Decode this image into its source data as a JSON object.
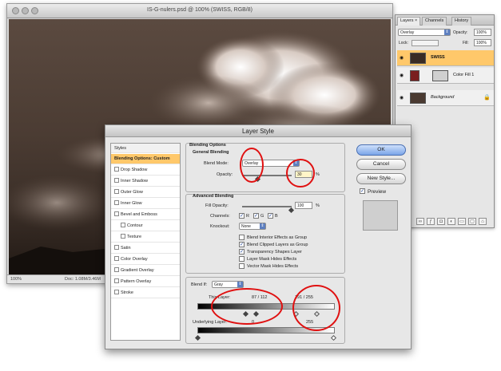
{
  "document_window": {
    "title": "IS-G-nulers.psd @ 100% (SWISS, RGB/8)",
    "zoom": "100%",
    "doc_size": "Doc: 1.08M/3.46M"
  },
  "layers_panel": {
    "tabs": [
      "Layers ×",
      "Channels",
      "History"
    ],
    "blend_mode": "Overlay",
    "opacity_label": "Opacity:",
    "opacity_value": "100%",
    "lock_label": "Lock:",
    "fill_label": "Fill:",
    "fill_value": "100%",
    "layers": [
      {
        "name": "SWISS",
        "selected": true
      },
      {
        "name": "Color Fill 1",
        "selected": false
      },
      {
        "name": "Background",
        "selected": false
      }
    ],
    "bottom_icons": [
      "link-icon",
      "fx-icon",
      "mask-icon",
      "adjustment-icon",
      "folder-icon",
      "new-layer-icon",
      "trash-icon"
    ]
  },
  "layer_style": {
    "title": "Layer Style",
    "styles_header": "Styles",
    "styles_list": [
      {
        "label": "Blending Options: Custom",
        "selected": true,
        "checkbox": false,
        "sub": false
      },
      {
        "label": "Drop Shadow",
        "selected": false,
        "checkbox": true,
        "sub": false
      },
      {
        "label": "Inner Shadow",
        "selected": false,
        "checkbox": true,
        "sub": false
      },
      {
        "label": "Outer Glow",
        "selected": false,
        "checkbox": true,
        "sub": false
      },
      {
        "label": "Inner Glow",
        "selected": false,
        "checkbox": true,
        "sub": false
      },
      {
        "label": "Bevel and Emboss",
        "selected": false,
        "checkbox": true,
        "sub": false
      },
      {
        "label": "Contour",
        "selected": false,
        "checkbox": true,
        "sub": true
      },
      {
        "label": "Texture",
        "selected": false,
        "checkbox": true,
        "sub": true
      },
      {
        "label": "Satin",
        "selected": false,
        "checkbox": true,
        "sub": false
      },
      {
        "label": "Color Overlay",
        "selected": false,
        "checkbox": true,
        "sub": false
      },
      {
        "label": "Gradient Overlay",
        "selected": false,
        "checkbox": true,
        "sub": false
      },
      {
        "label": "Pattern Overlay",
        "selected": false,
        "checkbox": true,
        "sub": false
      },
      {
        "label": "Stroke",
        "selected": false,
        "checkbox": true,
        "sub": false
      }
    ],
    "blending_options_title": "Blending Options",
    "general_blending_title": "General Blending",
    "blend_mode_label": "Blend Mode:",
    "blend_mode_value": "Overlay",
    "opacity_label": "Opacity:",
    "opacity_value": "30",
    "percent": "%",
    "advanced_blending_title": "Advanced Blending",
    "fill_opacity_label": "Fill Opacity:",
    "fill_opacity_value": "100",
    "channels_label": "Channels:",
    "channels": [
      "R",
      "G",
      "B"
    ],
    "knockout_label": "Knockout:",
    "knockout_value": "None",
    "checkboxes": [
      {
        "label": "Blend Interior Effects as Group",
        "checked": false
      },
      {
        "label": "Blend Clipped Layers as Group",
        "checked": true
      },
      {
        "label": "Transparency Shapes Layer",
        "checked": true
      },
      {
        "label": "Layer Mask Hides Effects",
        "checked": false
      },
      {
        "label": "Vector Mask Hides Effects",
        "checked": false
      }
    ],
    "blend_if_label": "Blend If:",
    "blend_if_value": "Gray",
    "this_layer_label": "This Layer:",
    "this_layer_low": "87 / 112",
    "this_layer_high": "191 / 255",
    "underlying_layer_label": "Underlying Layer:",
    "underlying_low": "0",
    "underlying_high": "255",
    "buttons": {
      "ok": "OK",
      "cancel": "Cancel",
      "new_style": "New Style...",
      "preview": "Preview"
    },
    "preview_checked": true
  },
  "colors": {
    "selection": "#ffc86a",
    "annotation_ring": "#e01010",
    "ok_button": "#7aa5e8"
  }
}
